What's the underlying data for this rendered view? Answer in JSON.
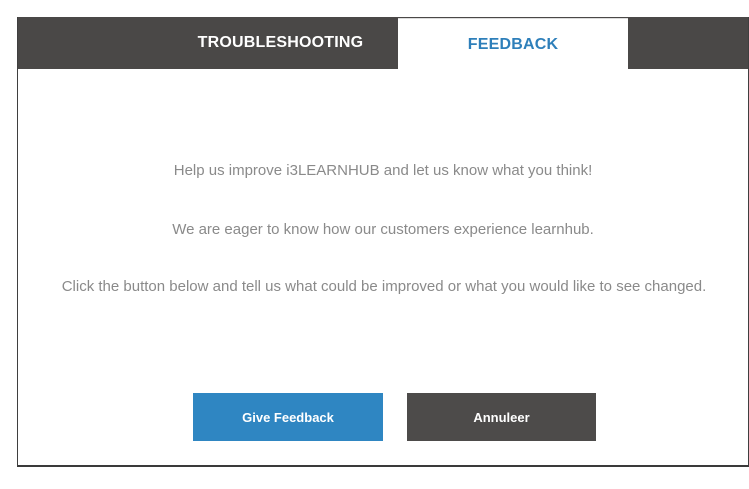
{
  "tabs": [
    {
      "label": "TROUBLESHOOTING",
      "active": false
    },
    {
      "label": "FEEDBACK",
      "active": true
    }
  ],
  "feedback": {
    "line1": "Help us improve i3LEARNHUB and let us know what you think!",
    "line2": "We are eager to know how our customers experience learnhub.",
    "line3": "Click the button below and tell us what could be improved or what you would like to see changed."
  },
  "buttons": {
    "give_feedback": "Give Feedback",
    "cancel": "Annuleer"
  },
  "colors": {
    "tabbar": "#4a4847",
    "accent": "#2f86c2",
    "active_tab_text": "#2e7fba",
    "cancel_button": "#4d4b4a",
    "body_text": "#8a8a8a"
  }
}
